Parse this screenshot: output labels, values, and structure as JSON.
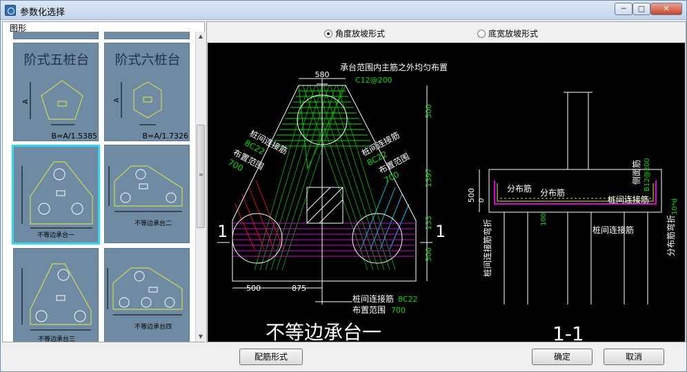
{
  "window": {
    "title": "参数化选择",
    "buttons": {
      "minimize": "─",
      "maximize": "□",
      "close": "✕"
    }
  },
  "left_panel": {
    "header": "图形",
    "thumbnails": [
      {
        "title": "阶式五桩台",
        "formula": "B=A/1.5385",
        "axis": "A"
      },
      {
        "title": "阶式六桩台",
        "formula": "B=A/1.7326",
        "axis": "A"
      },
      {
        "caption": "不等边承台一",
        "selected": true
      },
      {
        "caption": "不等边承台二"
      },
      {
        "caption": "不等边承台三"
      },
      {
        "caption": "不等边承台四"
      }
    ]
  },
  "options": {
    "angle_mode": "角度放坡形式",
    "width_mode": "底宽放坡形式",
    "selected": "angle_mode"
  },
  "drawing": {
    "top_note": "承台范围内主筋之外均匀布置",
    "top_rebar": "C12@200",
    "top_width": "580",
    "dims_right": [
      "500",
      "1397",
      "133",
      "500"
    ],
    "left_label_1": "桩间连接筋",
    "left_label_1_val": "8C22",
    "left_label_2": "布置范围",
    "left_label_2_val": "700",
    "right_label_1": "桩间连接筋",
    "right_label_1_val": "8C22",
    "right_label_2": "布置范围",
    "right_label_2_val": "700",
    "bottom_dims": [
      "500",
      "875"
    ],
    "bottom_label_1": "桩间连接筋",
    "bottom_label_1_val": "8C22",
    "bottom_label_2": "布置范围",
    "bottom_label_2_val": "700",
    "section_mark": "1",
    "plan_title": "不等边承台一",
    "section_title": "1-1",
    "sec_dist_1": "分布筋",
    "sec_dist_2": "分布筋",
    "sec_side": "侧面筋",
    "sec_side_val": "B12@200",
    "sec_pile_link": "桩间连接筋",
    "sec_pile_link_bottom": "桩间连接筋",
    "sec_pile_link_bend": "桩间连接筋弯折",
    "sec_dist_bend": "分布筋弯折",
    "sec_dim_500": "500",
    "sec_dim_0": "0",
    "sec_dim_100": "100",
    "sec_dim_10d": "10*d"
  },
  "footer": {
    "rebar_form": "配筋形式",
    "ok": "确定",
    "cancel": "取消"
  }
}
